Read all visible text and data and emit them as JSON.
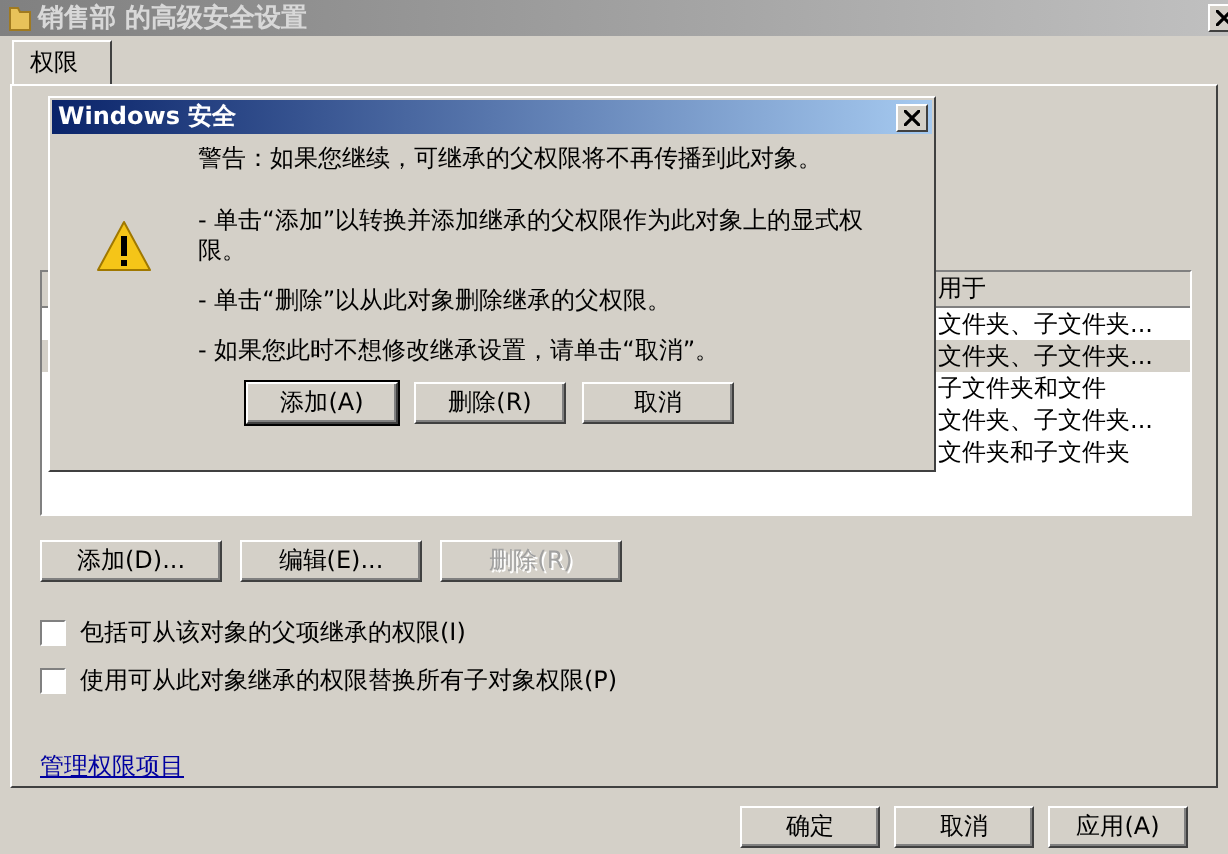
{
  "window": {
    "title": "销售部 的高级安全设置"
  },
  "tabs": [
    {
      "label": "权限",
      "selected": true
    }
  ],
  "permissions_table": {
    "columns": [
      {
        "label": "用于"
      }
    ],
    "rows": [
      {
        "applies_to": "文件夹、子文件夹...",
        "selected": false
      },
      {
        "applies_to": "文件夹、子文件夹...",
        "selected": true
      },
      {
        "applies_to": "子文件夹和文件",
        "selected": false
      },
      {
        "applies_to": "文件夹、子文件夹...",
        "selected": false
      },
      {
        "applies_to": "文件夹和子文件夹",
        "selected": false
      }
    ]
  },
  "buttons": [
    {
      "label": "添加(D)...",
      "disabled": false
    },
    {
      "label": "编辑(E)...",
      "disabled": false
    },
    {
      "label": "删除(R)",
      "disabled": true
    }
  ],
  "checkboxes": [
    {
      "label": "包括可从该对象的父项继承的权限(I)",
      "checked": false
    },
    {
      "label": "使用可从此对象继承的权限替换所有子对象权限(P)",
      "checked": false
    }
  ],
  "link": "管理权限项目",
  "footer_buttons": [
    "确定",
    "取消",
    "应用(A)"
  ],
  "dialog": {
    "title": "Windows 安全",
    "warning": "警告：如果您继续，可继承的父权限将不再传播到此对象。",
    "instructions": [
      "- 单击“添加”以转换并添加继承的父权限作为此对象上的显式权限。",
      "- 单击“删除”以从此对象删除继承的父权限。",
      "- 如果您此时不想修改继承设置，请单击“取消”。"
    ],
    "buttons": [
      "添加(A)",
      "删除(R)",
      "取消"
    ]
  }
}
